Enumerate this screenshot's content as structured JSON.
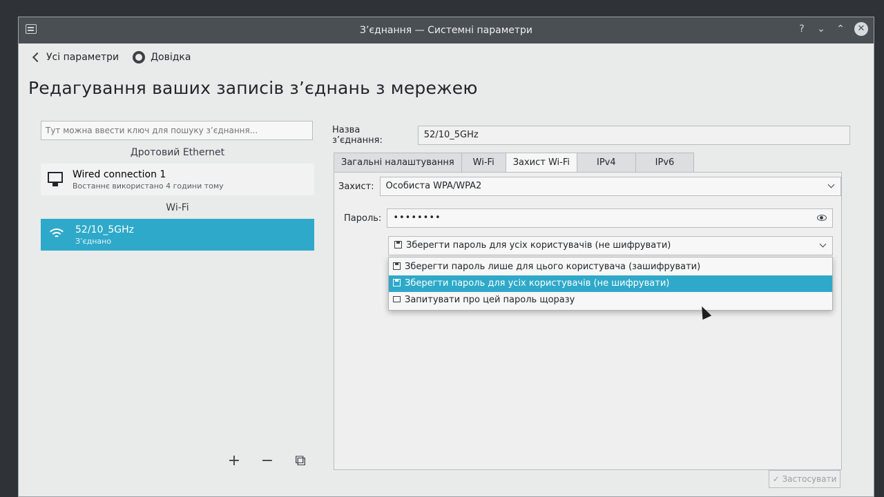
{
  "window": {
    "title": "З’єднання — Системні параметри",
    "buttons": {
      "help": "?",
      "minimize": "⌄",
      "maximize": "⌃",
      "close": "✕"
    }
  },
  "toolbar": {
    "back_label": "Усі параметри",
    "help_label": "Довідка"
  },
  "page_title": "Редагування ваших записів з’єднань з мережею",
  "left": {
    "search_placeholder": "Тут можна ввести ключ для пошуку з’єднання...",
    "ethernet_section": "Дротовий Ethernet",
    "wired": {
      "name": "Wired connection 1",
      "sub": "Востаннє використано 4 години тому"
    },
    "wifi_section": "Wi-Fi",
    "wifi": {
      "name": "52/10_5GHz",
      "sub": "З’єднано"
    },
    "bottom": {
      "add": "+",
      "remove": "−",
      "export": "⧉"
    }
  },
  "right": {
    "connection_name_label": "Назва з’єднання:",
    "connection_name_value": "52/10_5GHz",
    "tabs": [
      {
        "label": "Загальні налаштування"
      },
      {
        "label": "Wi-Fi"
      },
      {
        "label": "Захист Wi-Fi"
      },
      {
        "label": "IPv4"
      },
      {
        "label": "IPv6"
      }
    ],
    "security_label": "Захист:",
    "security_value": "Особиста WPA/WPA2",
    "password_label": "Пароль:",
    "password_value": "••••••••",
    "password_store_value": "Зберегти пароль для усіх користувачів (не шифрувати)",
    "dropdown_items": [
      {
        "label": "Зберегти пароль лише для цього користувача (зашифрувати)"
      },
      {
        "label": "Зберегти пароль для усіх користувачів (не шифрувати)"
      },
      {
        "label": "Запитувати про цей пароль щоразу"
      }
    ],
    "apply_label": "✓ Застосувати"
  },
  "colors": {
    "accent": "#2fa9c9",
    "titlebar": "#4a4f54",
    "background": "#e9eaea"
  }
}
